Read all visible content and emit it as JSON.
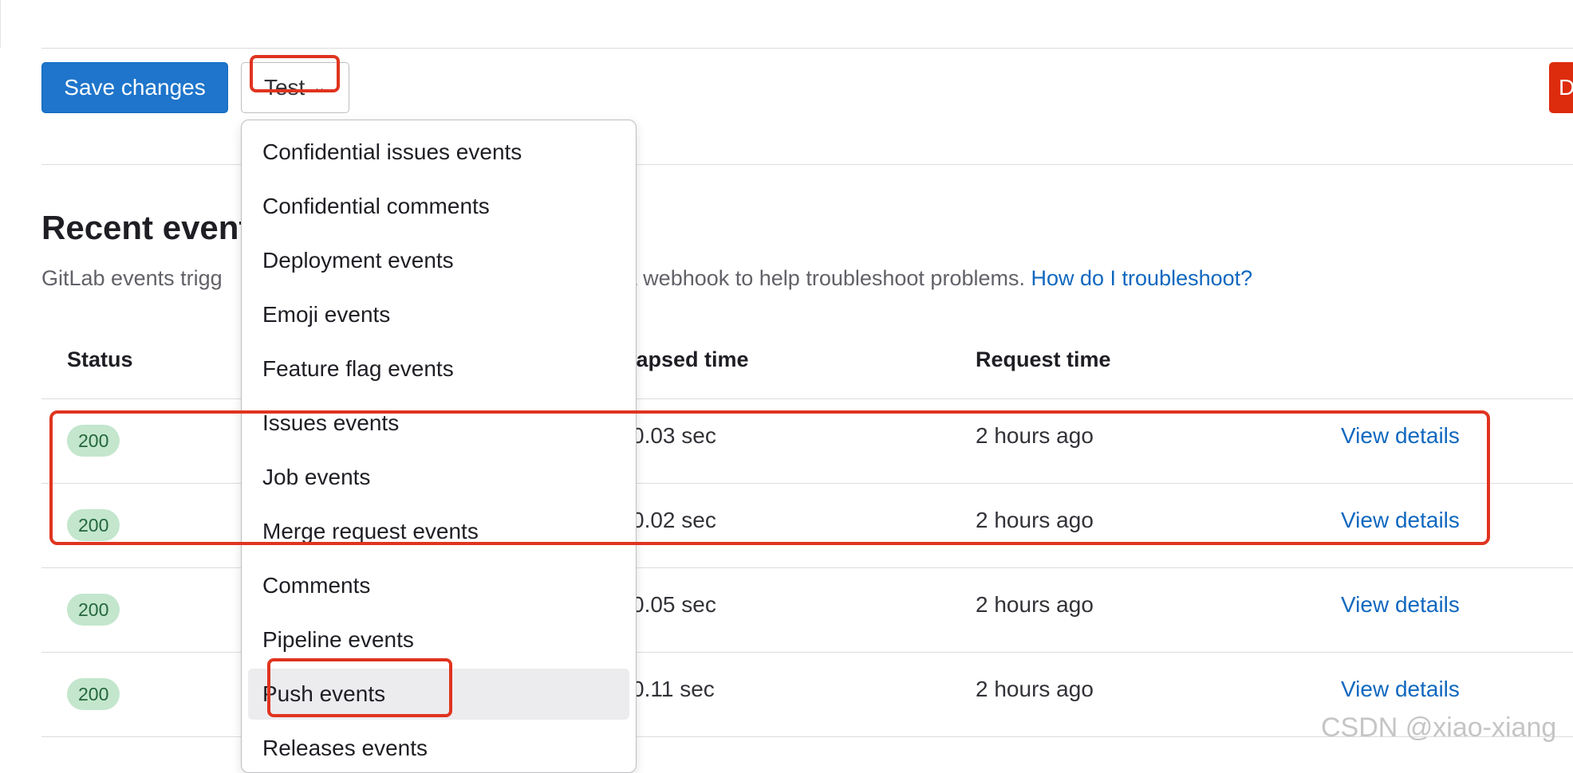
{
  "toolbar": {
    "save_label": "Save changes",
    "test_label": "Test",
    "delete_label": "D"
  },
  "recent_events": {
    "heading": "Recent events",
    "description_start": "GitLab events trigg",
    "description_end": "of a webhook to help troubleshoot problems.",
    "troubleshoot_link": "How do I troubleshoot?"
  },
  "table": {
    "headers": {
      "status": "Status",
      "elapsed": "Elapsed time",
      "request": "Request time"
    },
    "rows": [
      {
        "status": "200",
        "elapsed": "0.03 sec",
        "request": "2 hours ago",
        "link": "View details"
      },
      {
        "status": "200",
        "elapsed": "0.02 sec",
        "request": "2 hours ago",
        "link": "View details"
      },
      {
        "status": "200",
        "elapsed": "0.05 sec",
        "request": "2 hours ago",
        "link": "View details"
      },
      {
        "status": "200",
        "elapsed": "0.11 sec",
        "request": "2 hours ago",
        "link": "View details"
      }
    ]
  },
  "dropdown": {
    "items": [
      "Confidential issues events",
      "Confidential comments",
      "Deployment events",
      "Emoji events",
      "Feature flag events",
      "Issues events",
      "Job events",
      "Merge request events",
      "Comments",
      "Pipeline events",
      "Push events",
      "Releases events"
    ],
    "highlighted": "Push events"
  },
  "watermark": "CSDN @xiao-xiang",
  "colors": {
    "primary": "#1f75cb",
    "danger": "#dd2b0e",
    "link": "#1068bf",
    "success_badge_bg": "#c3e6cd",
    "success_badge_text": "#24663b",
    "annotation": "#e0341f"
  },
  "icons": {
    "test_caret": "chevron-down-icon"
  }
}
